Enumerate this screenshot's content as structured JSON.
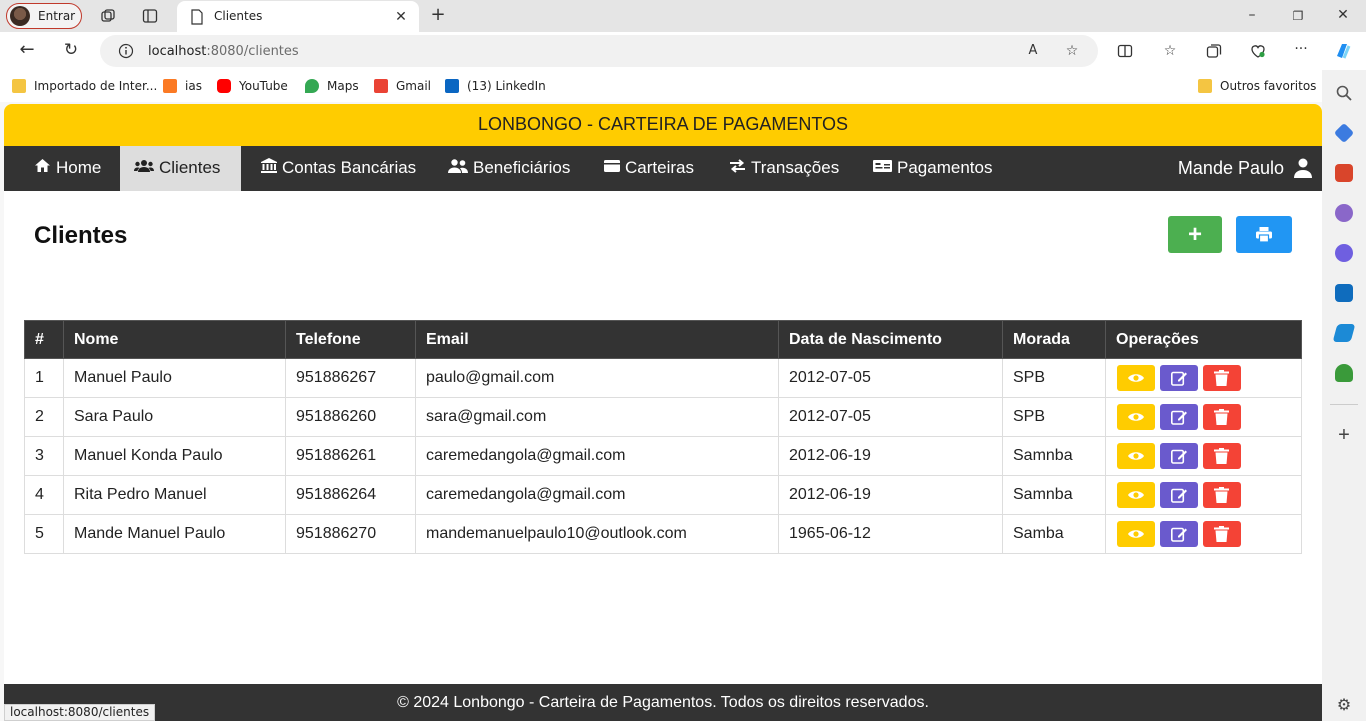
{
  "browser": {
    "profile_label": "Entrar",
    "tab_title": "Clientes",
    "url_host": "localhost",
    "url_path": ":8080/clientes",
    "status_url": "localhost:8080/clientes",
    "bookmarks": [
      "Importado de Inter...",
      "ias",
      "YouTube",
      "Maps",
      "Gmail",
      "(13) LinkedIn"
    ],
    "other_favorites": "Outros favoritos"
  },
  "app": {
    "banner": "LONBONGO - CARTEIRA DE PAGAMENTOS",
    "nav": [
      {
        "label": "Home",
        "icon": "home-icon"
      },
      {
        "label": "Clientes",
        "icon": "users-icon",
        "active": true
      },
      {
        "label": "Contas Bancárias",
        "icon": "bank-icon"
      },
      {
        "label": "Beneficiários",
        "icon": "user-friends-icon"
      },
      {
        "label": "Carteiras",
        "icon": "wallet-icon"
      },
      {
        "label": "Transações",
        "icon": "exchange-icon"
      },
      {
        "label": "Pagamentos",
        "icon": "money-check-icon"
      }
    ],
    "user_name": "Mande Paulo",
    "page_title": "Clientes",
    "add_label": "+",
    "colors": {
      "banner": "#ffcc00",
      "nav": "#333333",
      "add": "#4caf50",
      "print": "#2196f3",
      "view": "#ffcc00",
      "edit": "#6a5acd",
      "delete": "#f44336"
    },
    "table": {
      "headers": [
        "#",
        "Nome",
        "Telefone",
        "Email",
        "Data de Nascimento",
        "Morada",
        "Operações"
      ],
      "rows": [
        [
          "1",
          "Manuel Paulo",
          "951886267",
          "paulo@gmail.com",
          "2012-07-05",
          "SPB"
        ],
        [
          "2",
          "Sara Paulo",
          "951886260",
          "sara@gmail.com",
          "2012-07-05",
          "SPB"
        ],
        [
          "3",
          "Manuel Konda Paulo",
          "951886261",
          "caremedangola@gmail.com",
          "2012-06-19",
          "Samnba"
        ],
        [
          "4",
          "Rita Pedro Manuel",
          "951886264",
          "caremedangola@gmail.com",
          "2012-06-19",
          "Samnba"
        ],
        [
          "5",
          "Mande Manuel Paulo",
          "951886270",
          "mandemanuelpaulo10@outlook.com",
          "1965-06-12",
          "Samba"
        ]
      ]
    },
    "footer": "© 2024 Lonbongo - Carteira de Pagamentos. Todos os direitos reservados."
  }
}
